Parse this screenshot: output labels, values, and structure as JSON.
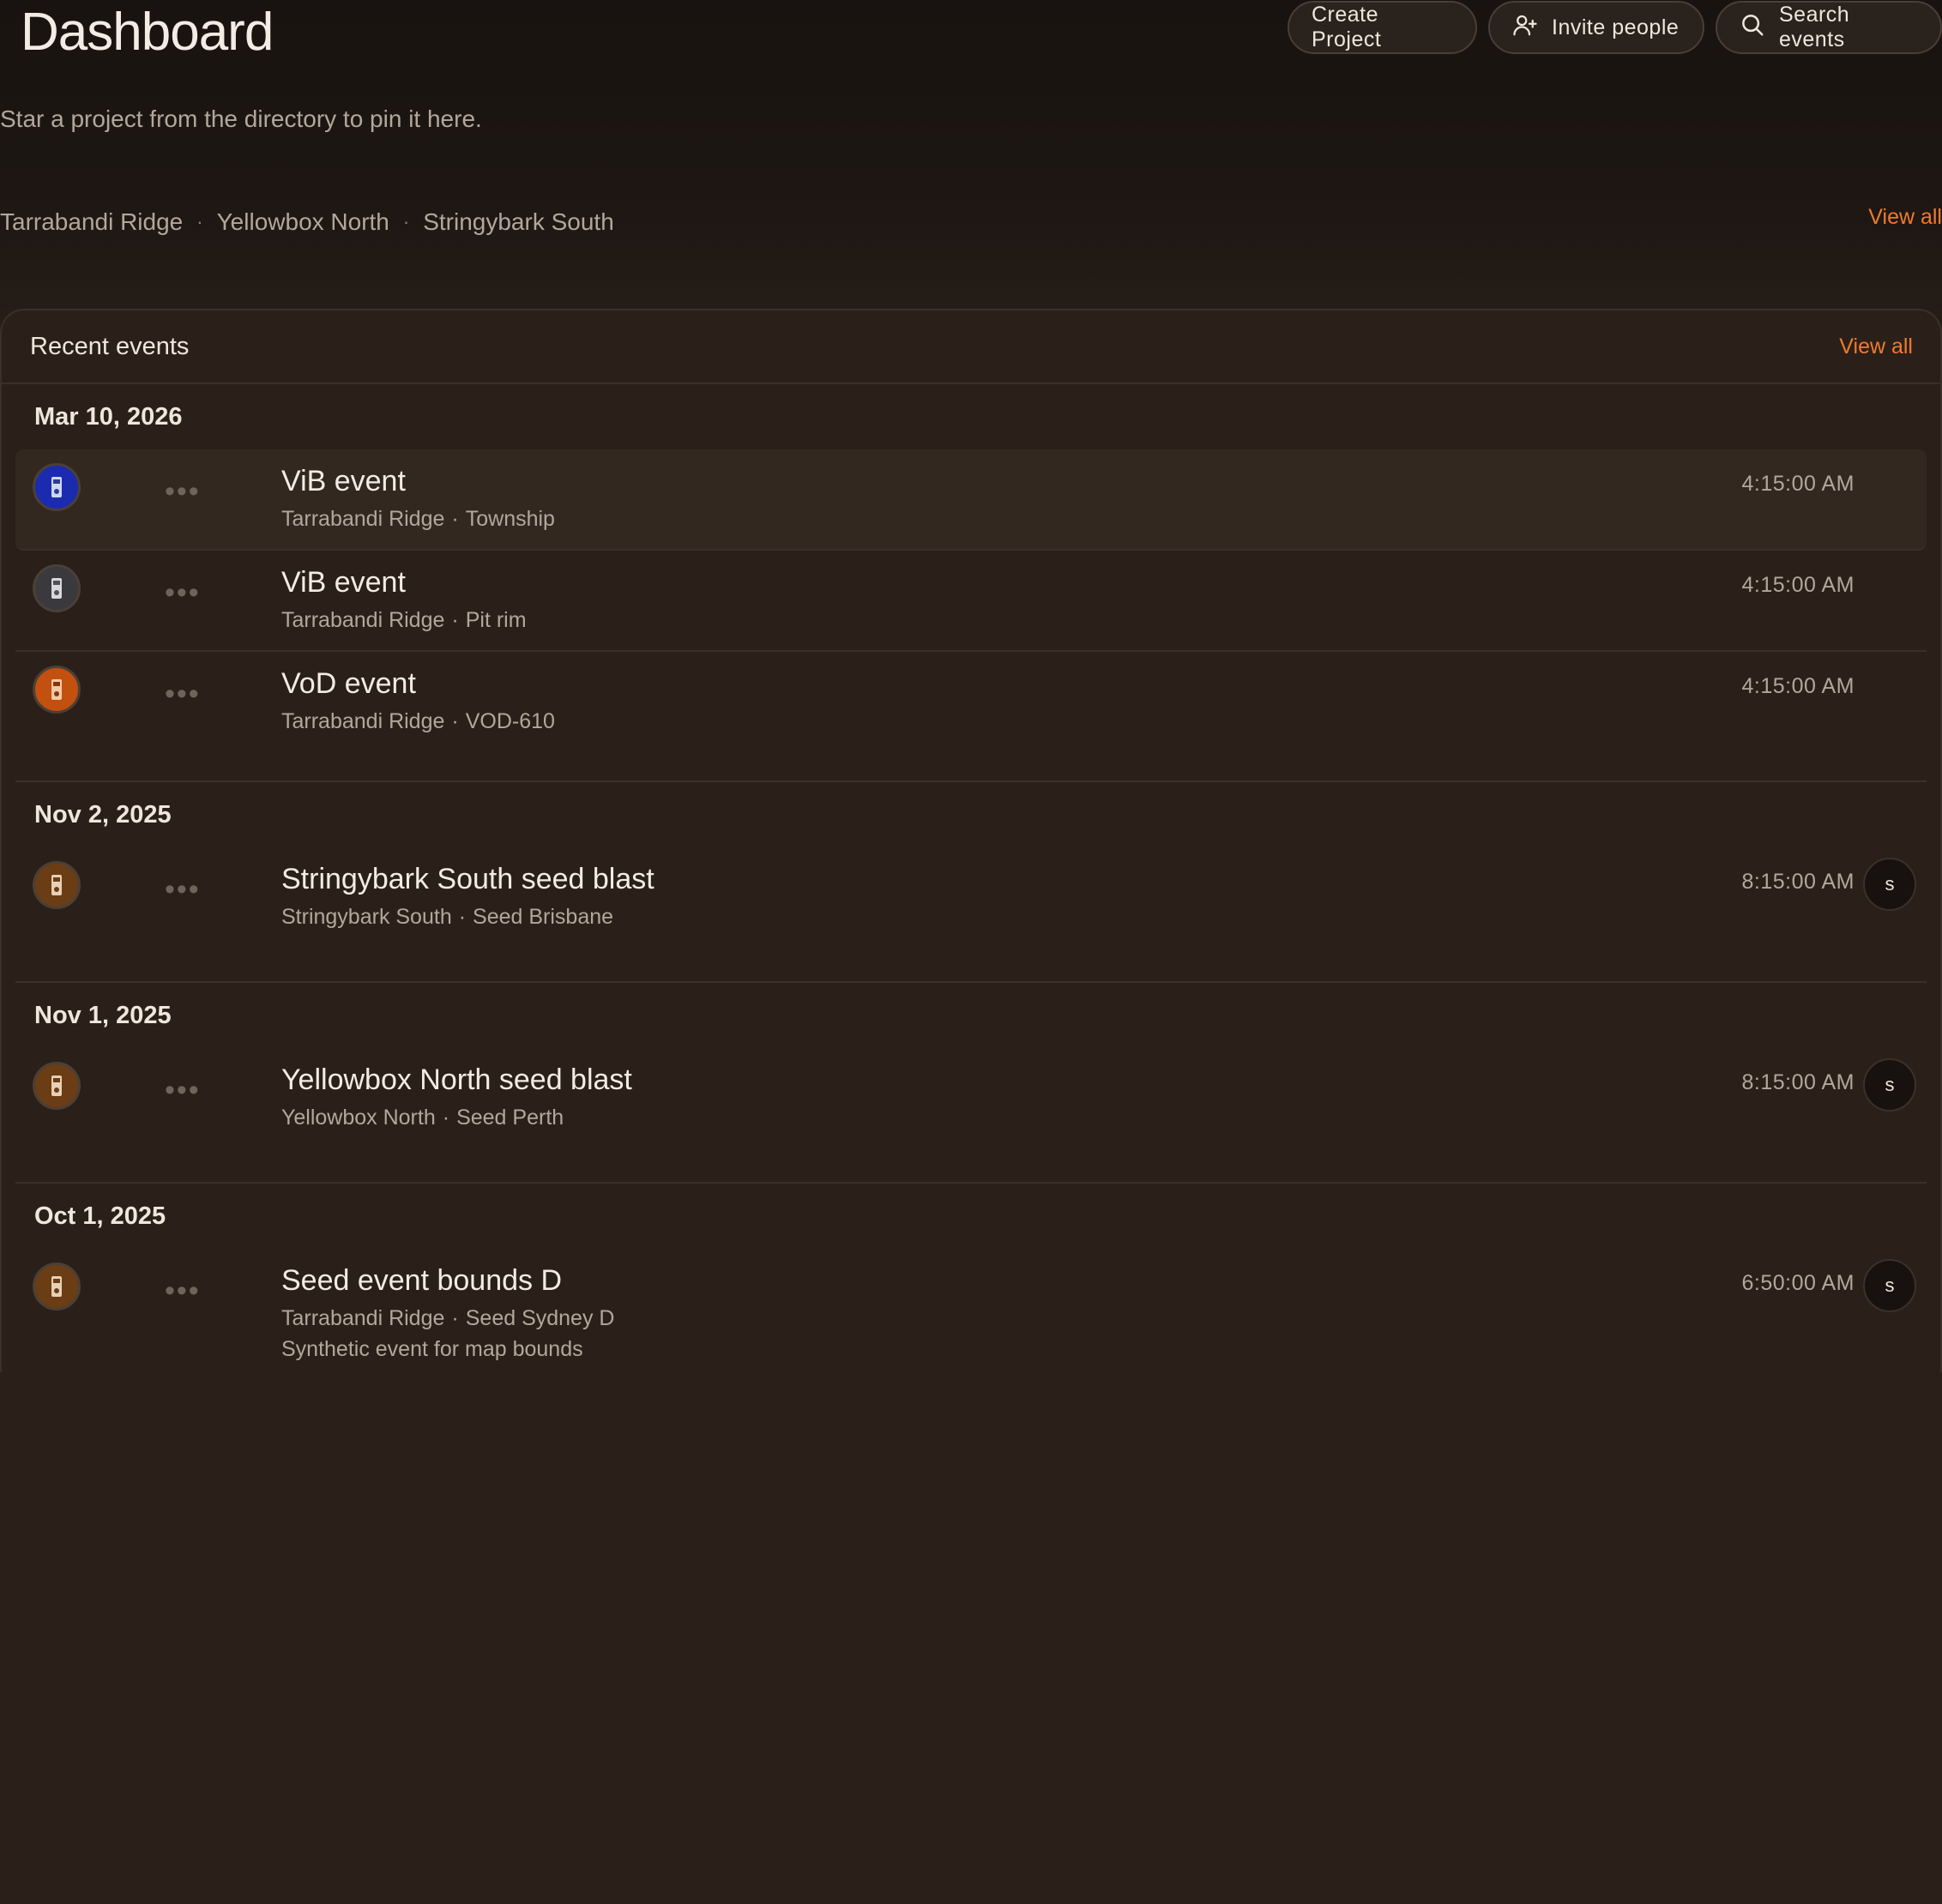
{
  "header": {
    "title": "Dashboard",
    "create_label": "Create Project",
    "invite_label": "Invite people",
    "search_label": "Search events"
  },
  "pinned": {
    "hint": "Star a project from the directory to pin it here.",
    "projects": [
      "Tarrabandi Ridge",
      "Yellowbox North",
      "Stringybark South"
    ],
    "separator": "·",
    "view_all": "View all"
  },
  "recent": {
    "label": "Recent events",
    "view_all": "View all",
    "groups": [
      {
        "date": "Mar 10, 2026",
        "events": [
          {
            "title": "ViB event",
            "project": "Tarrabandi Ridge",
            "location": "Township",
            "time": "4:15:00 AM",
            "icon": "device-blue-icon"
          },
          {
            "title": "ViB event",
            "project": "Tarrabandi Ridge",
            "location": "Pit rim",
            "time": "4:15:00 AM",
            "icon": "device-grey-icon"
          },
          {
            "title": "VoD event",
            "project": "Tarrabandi Ridge",
            "location": "VOD-610",
            "time": "4:15:00 AM",
            "icon": "device-orange-icon"
          }
        ]
      },
      {
        "date": "Nov 2, 2025",
        "events": [
          {
            "title": "Stringybark South seed blast",
            "project": "Stringybark South",
            "location": "Seed Brisbane",
            "time": "8:15:00 AM",
            "avatar": "s",
            "icon": "device-brown-icon"
          }
        ]
      },
      {
        "date": "Nov 1, 2025",
        "events": [
          {
            "title": "Yellowbox North seed blast",
            "project": "Yellowbox North",
            "location": "Seed Perth",
            "time": "8:15:00 AM",
            "avatar": "s",
            "icon": "device-brown-icon"
          }
        ]
      },
      {
        "date": "Oct 1, 2025",
        "events": [
          {
            "title": "Seed event bounds D",
            "project": "Tarrabandi Ridge",
            "location": "Seed Sydney D",
            "description": "Synthetic event for map bounds",
            "time": "6:50:00 AM",
            "avatar": "s",
            "icon": "device-brown-icon"
          }
        ]
      }
    ]
  },
  "colors": {
    "accent": "#f07a2c",
    "background": "#2a2019",
    "device_blue": "#1a2bb0",
    "device_grey": "#3a3a3e",
    "device_orange": "#c2500e",
    "device_brown": "#6a3d14"
  },
  "more_glyph": "•••"
}
